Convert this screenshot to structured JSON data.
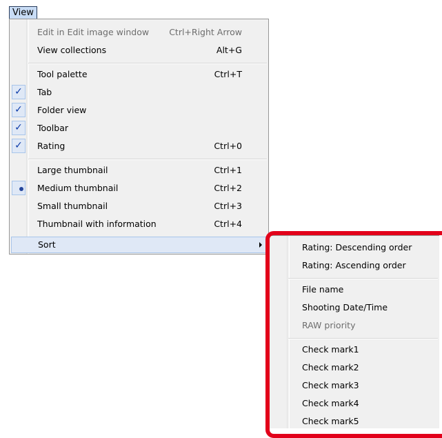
{
  "menubar": {
    "view_label": "View"
  },
  "view_menu": {
    "items": [
      {
        "label": "Edit in Edit image window",
        "shortcut": "Ctrl+Right Arrow"
      },
      {
        "label": "View collections",
        "shortcut": "Alt+G"
      },
      {
        "label": "Tool palette",
        "shortcut": "Ctrl+T"
      },
      {
        "label": "Tab",
        "shortcut": ""
      },
      {
        "label": "Folder view",
        "shortcut": ""
      },
      {
        "label": "Toolbar",
        "shortcut": ""
      },
      {
        "label": "Rating",
        "shortcut": "Ctrl+0"
      },
      {
        "label": "Large thumbnail",
        "shortcut": "Ctrl+1"
      },
      {
        "label": "Medium thumbnail",
        "shortcut": "Ctrl+2"
      },
      {
        "label": "Small thumbnail",
        "shortcut": "Ctrl+3"
      },
      {
        "label": "Thumbnail with information",
        "shortcut": "Ctrl+4"
      },
      {
        "label": "Sort",
        "shortcut": ""
      }
    ],
    "check_mark": "✓"
  },
  "sort_menu": {
    "items": [
      {
        "label": "Rating: Descending order"
      },
      {
        "label": "Rating: Ascending order"
      },
      {
        "label": "File name"
      },
      {
        "label": "Shooting Date/Time"
      },
      {
        "label": "RAW priority"
      },
      {
        "label": "Check mark1"
      },
      {
        "label": "Check mark2"
      },
      {
        "label": "Check mark3"
      },
      {
        "label": "Check mark4"
      },
      {
        "label": "Check mark5"
      }
    ]
  },
  "colors": {
    "highlight_border": "#e2001a",
    "menu_background": "#f0f0f0",
    "hover_background": "#dfe8f6"
  }
}
